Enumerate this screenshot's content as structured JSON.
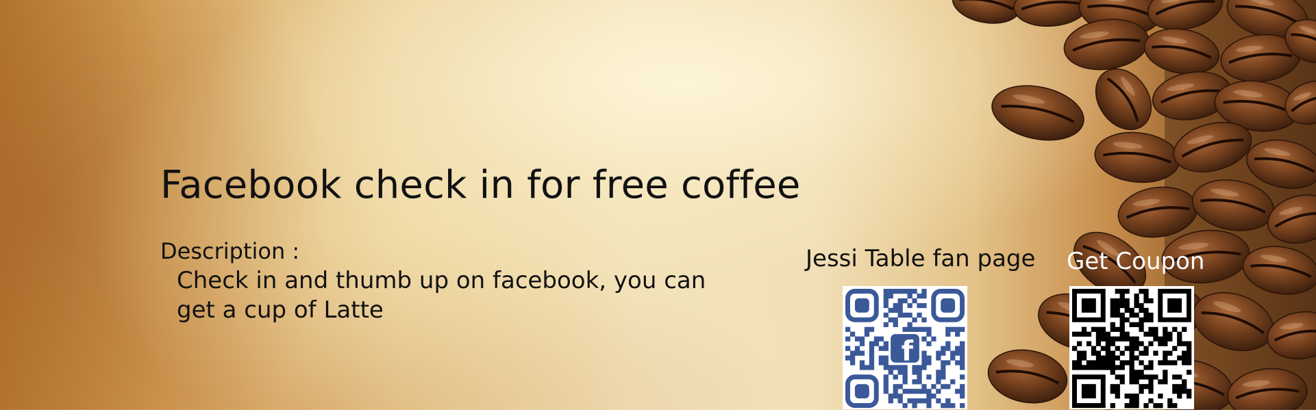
{
  "title": "Facebook check in for free coffee",
  "description": {
    "label": "Description :",
    "line1": "Check in and thumb up on facebook, you can",
    "line2": "get a cup of Latte"
  },
  "qr_codes": [
    {
      "label": "Jessi Table fan page",
      "color": "#3b5998",
      "icon": "facebook-f-icon"
    },
    {
      "label": "Get Coupon",
      "color": "#000000"
    }
  ],
  "colors": {
    "text": "#111111",
    "coupon_label": "#ffffff",
    "facebook_blue": "#3b5998"
  }
}
